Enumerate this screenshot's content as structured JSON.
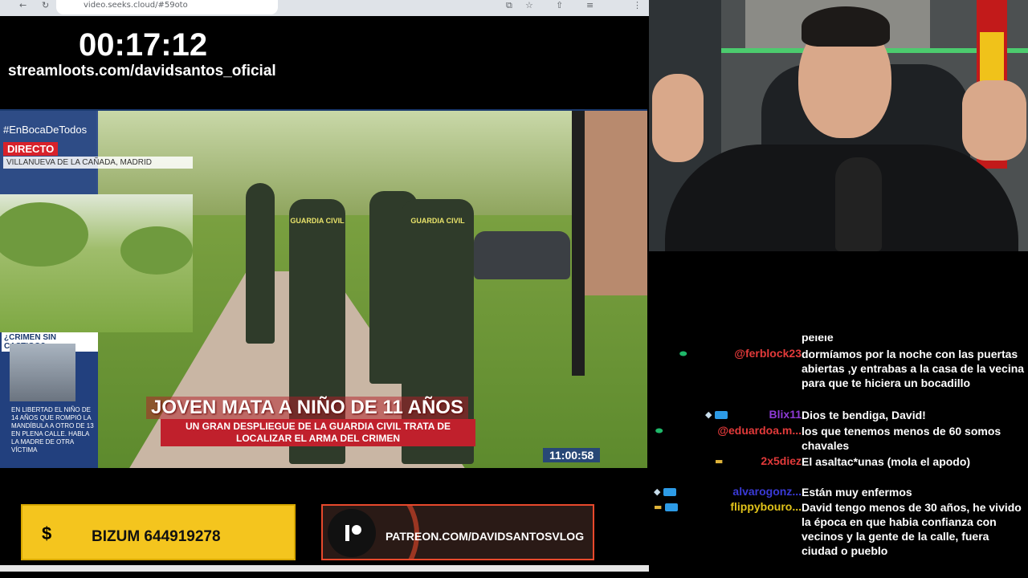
{
  "browser": {
    "url": "video.seeks.cloud/#59oto",
    "nav_icons": [
      "←",
      "↻"
    ],
    "toolbar_icons": [
      "⧉",
      "☆",
      "⇧",
      "≡",
      "⋮"
    ]
  },
  "stream": {
    "timer": "00:17:12",
    "streamloots": "streamloots.com/davidsantos_oficial"
  },
  "tv": {
    "hashtag": "#EnBocaDeTodos",
    "live": "DIRECTO",
    "location": "VILLANUEVA DE LA CAÑADA, MADRID",
    "guard_label": "GUARDIA CIVIL",
    "side_title": "¿CRIMEN SIN CASTIGO?",
    "side_text": "EN LIBERTAD EL NIÑO DE 14 AÑOS QUE ROMPIÓ LA MANDÍBULA A OTRO DE 13 EN PLENA CALLE. HABLA LA MADRE DE OTRA VÍCTIMA",
    "headline": "JOVEN MATA A NIÑO DE 11 AÑOS",
    "subhead": "UN GRAN DESPLIEGUE DE LA GUARDIA CIVIL TRATA DE LOCALIZAR EL ARMA DEL CRIMEN",
    "clock": "11:00:58"
  },
  "donations": {
    "bizum_symbol": "$",
    "bizum": "BIZUM 644919278",
    "patreon": "PATREON.COM/DAVIDSANTOSVLOG"
  },
  "chat": {
    "partial_top": "pelele",
    "messages": [
      {
        "user": "@ferblock23",
        "color": "#e23a3a",
        "badges": "green",
        "text": "dormíamos por la noche con las puertas abiertas ,y entrabas a la casa de la vecina para que te hiciera un bocadillo"
      },
      {
        "user": "Blix11",
        "color": "#8e3ad6",
        "badges": "diamond-blue",
        "text": "Dios te bendiga, David!"
      },
      {
        "user": "@eduardoa.m...",
        "color": "#e23a3a",
        "badges": "green",
        "text": "los que tenemos menos de 60 somos chavales"
      },
      {
        "user": "2x5diez",
        "color": "#e23a3a",
        "badges": "gold",
        "text": "El asaltac*unas (mola el apodo)"
      },
      {
        "user": "alvarogonz...",
        "color": "#3a3ad6",
        "badges": "diamond-blue",
        "text": "Están muy enfermos"
      },
      {
        "user": "flippybouro...",
        "color": "#e0c21a",
        "badges": "gold-blue",
        "text": "David tengo menos de 30 años, he vivido la época en que habia confianza con vecinos y la gente de la calle, fuera ciudad o pueblo"
      }
    ]
  }
}
